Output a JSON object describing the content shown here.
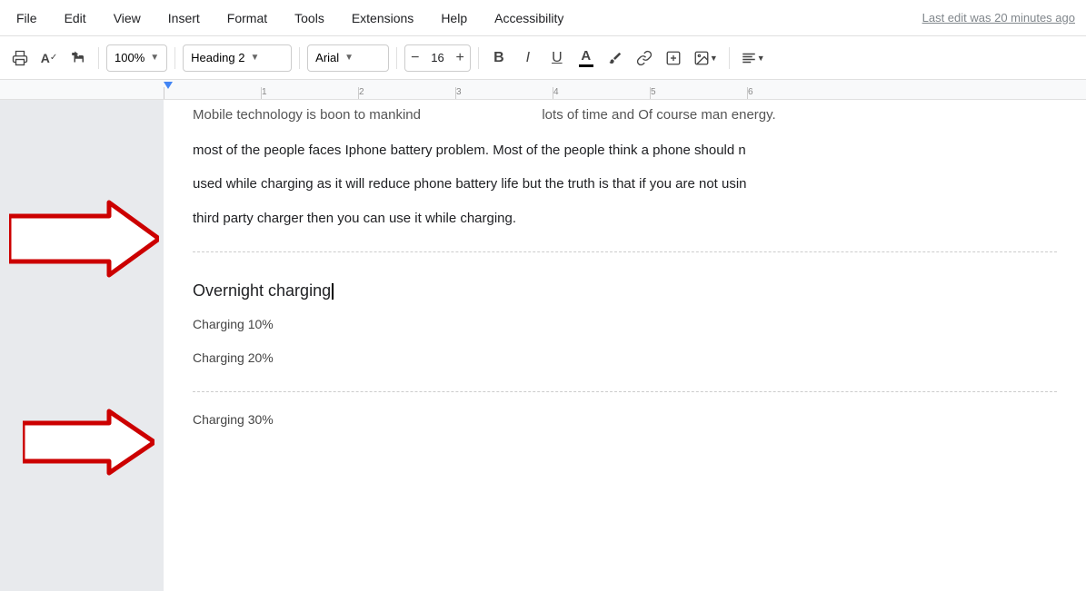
{
  "menu": {
    "items": [
      {
        "id": "file",
        "label": "File"
      },
      {
        "id": "edit",
        "label": "Edit"
      },
      {
        "id": "view",
        "label": "View"
      },
      {
        "id": "insert",
        "label": "Insert"
      },
      {
        "id": "format",
        "label": "Format"
      },
      {
        "id": "tools",
        "label": "Tools"
      },
      {
        "id": "extensions",
        "label": "Extensions"
      },
      {
        "id": "help",
        "label": "Help"
      },
      {
        "id": "accessibility",
        "label": "Accessibility"
      }
    ],
    "last_edit": "Last edit was 20 minutes ago"
  },
  "toolbar": {
    "zoom": "100%",
    "heading": "Heading 2",
    "font": "Arial",
    "font_size": "16",
    "bold_label": "B",
    "italic_label": "I",
    "underline_label": "U"
  },
  "ruler": {
    "marks": [
      "",
      "1",
      "2",
      "3",
      "4",
      "5",
      "6"
    ]
  },
  "document": {
    "paragraphs": [
      "Mobile technology is boon to mankind",
      "lots of time and Of course man energy.",
      "most of the people faces Iphone battery problem. Most of the people think a phone should n",
      "used while charging as it will reduce phone battery life but the truth is that if you are not usin",
      "third party charger then you can use it while charging."
    ],
    "heading": "Overnight charging",
    "charging_items": [
      "Charging 10%",
      "Charging 20%",
      "Charging 30%"
    ]
  }
}
